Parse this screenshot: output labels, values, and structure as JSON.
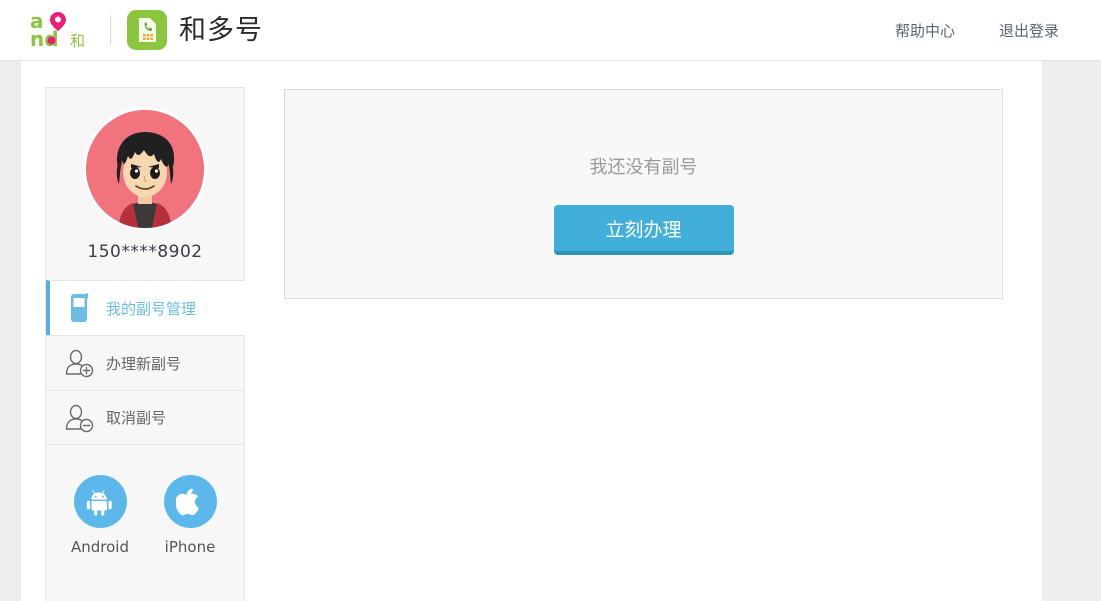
{
  "header": {
    "brand_logo_alt": "and",
    "app_icon_alt": "sim-card",
    "title": "和多号",
    "nav": [
      {
        "label": "帮助中心",
        "name": "help-center"
      },
      {
        "label": "退出登录",
        "name": "logout"
      }
    ]
  },
  "sidebar": {
    "avatar_alt": "user-avatar",
    "phone_number": "150****8902",
    "menu": [
      {
        "label": "我的副号管理",
        "icon": "mobile-phone-icon",
        "active": true
      },
      {
        "label": "办理新副号",
        "icon": "user-add-icon",
        "active": false
      },
      {
        "label": "取消副号",
        "icon": "user-remove-icon",
        "active": false
      }
    ],
    "apps": [
      {
        "label": "Android",
        "icon": "android-icon"
      },
      {
        "label": "iPhone",
        "icon": "apple-icon"
      }
    ]
  },
  "main": {
    "empty_text": "我还没有副号",
    "cta_label": "立刻办理"
  },
  "colors": {
    "accent_blue": "#42afda",
    "accent_blue_dark": "#2f93bb",
    "brand_green": "#8cc63e",
    "brand_pink": "#ec1e79",
    "avatar_bg": "#f1737d",
    "page_bg": "#ededed"
  }
}
